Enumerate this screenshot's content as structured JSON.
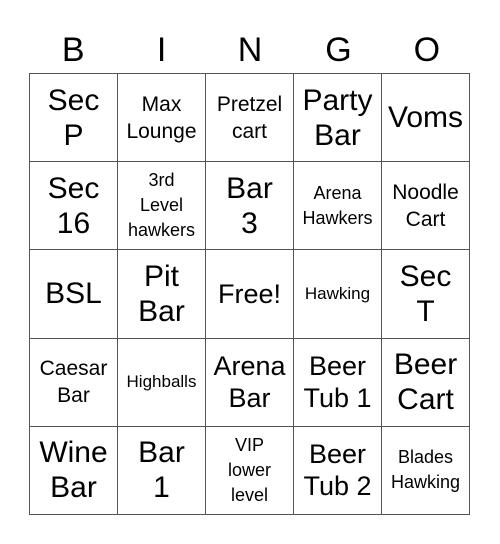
{
  "header": {
    "letters": [
      "B",
      "I",
      "N",
      "G",
      "O"
    ]
  },
  "card": {
    "rows": [
      [
        {
          "text": "Sec\nP",
          "size": "xl"
        },
        {
          "text": "Max\nLounge",
          "size": "m"
        },
        {
          "text": "Pretzel\ncart",
          "size": "m"
        },
        {
          "text": "Party\nBar",
          "size": "xl"
        },
        {
          "text": "Voms",
          "size": "xl"
        }
      ],
      [
        {
          "text": "Sec\n16",
          "size": "xl"
        },
        {
          "text": "3rd\nLevel\nhawkers",
          "size": "s"
        },
        {
          "text": "Bar\n3",
          "size": "xl"
        },
        {
          "text": "Arena\nHawkers",
          "size": "s"
        },
        {
          "text": "Noodle\nCart",
          "size": "m"
        }
      ],
      [
        {
          "text": "BSL",
          "size": "xl"
        },
        {
          "text": "Pit\nBar",
          "size": "xl"
        },
        {
          "text": "Free!",
          "size": "l"
        },
        {
          "text": "Hawking",
          "size": "xs"
        },
        {
          "text": "Sec\nT",
          "size": "xl"
        }
      ],
      [
        {
          "text": "Caesar\nBar",
          "size": "m"
        },
        {
          "text": "Highballs",
          "size": "xs"
        },
        {
          "text": "Arena\nBar",
          "size": "l"
        },
        {
          "text": "Beer\nTub 1",
          "size": "l"
        },
        {
          "text": "Beer\nCart",
          "size": "xl"
        }
      ],
      [
        {
          "text": "Wine\nBar",
          "size": "xl"
        },
        {
          "text": "Bar\n1",
          "size": "xl"
        },
        {
          "text": "VIP\nlower\nlevel",
          "size": "s"
        },
        {
          "text": "Beer\nTub 2",
          "size": "l"
        },
        {
          "text": "Blades\nHawking",
          "size": "s"
        }
      ]
    ]
  }
}
